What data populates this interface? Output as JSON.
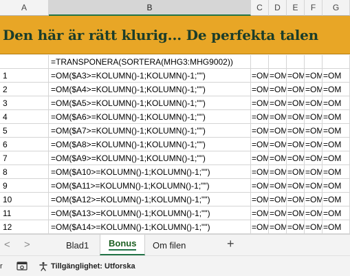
{
  "columns": [
    "A",
    "B",
    "C",
    "D",
    "E",
    "F",
    "G"
  ],
  "selected_column": "B",
  "title": "Den här är rätt klurig... De perfekta talen",
  "row2": {
    "a": "",
    "b": "=TRANSPONERA(SORTERA(MHG3:MHG9002))"
  },
  "rows": [
    {
      "a": "1",
      "b": "=OM($A3>=KOLUMN()-1;KOLUMN()-1;\"\")"
    },
    {
      "a": "2",
      "b": "=OM($A4>=KOLUMN()-1;KOLUMN()-1;\"\")"
    },
    {
      "a": "3",
      "b": "=OM($A5>=KOLUMN()-1;KOLUMN()-1;\"\")"
    },
    {
      "a": "4",
      "b": "=OM($A6>=KOLUMN()-1;KOLUMN()-1;\"\")"
    },
    {
      "a": "5",
      "b": "=OM($A7>=KOLUMN()-1;KOLUMN()-1;\"\")"
    },
    {
      "a": "6",
      "b": "=OM($A8>=KOLUMN()-1;KOLUMN()-1;\"\")"
    },
    {
      "a": "7",
      "b": "=OM($A9>=KOLUMN()-1;KOLUMN()-1;\"\")"
    },
    {
      "a": "8",
      "b": "=OM($A10>=KOLUMN()-1;KOLUMN()-1;\"\")"
    },
    {
      "a": "9",
      "b": "=OM($A11>=KOLUMN()-1;KOLUMN()-1;\"\")"
    },
    {
      "a": "10",
      "b": "=OM($A12>=KOLUMN()-1;KOLUMN()-1;\"\")"
    },
    {
      "a": "11",
      "b": "=OM($A13>=KOLUMN()-1;KOLUMN()-1;\"\")"
    },
    {
      "a": "12",
      "b": "=OM($A14>=KOLUMN()-1;KOLUMN()-1;\"\")"
    }
  ],
  "spill_text": "=OM",
  "tabs": {
    "prev": "<",
    "next": ">",
    "sheets": [
      "Blad1",
      "Bonus",
      "Om filen"
    ],
    "active": "Bonus",
    "add": "+"
  },
  "status": {
    "left_fragment": "r",
    "accessibility": "Tillgänglighet: Utforska"
  },
  "colors": {
    "title_fill": "#e8a626",
    "title_text": "#1b3d2a",
    "accent": "#217346"
  }
}
